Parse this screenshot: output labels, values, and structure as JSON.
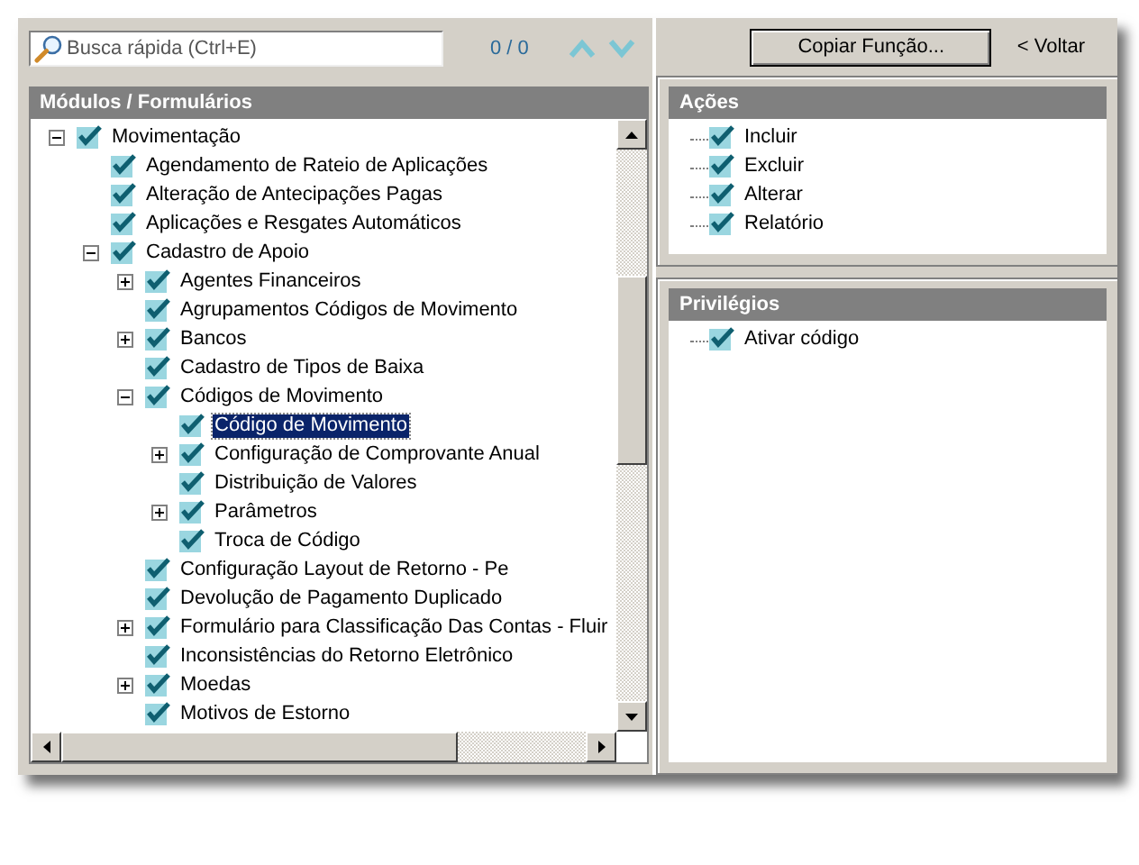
{
  "search": {
    "placeholder": "Busca rápida (Ctrl+E)",
    "count": "0 / 0"
  },
  "modules": {
    "title": "Módulos / Formulários",
    "items": [
      {
        "label": "Movimentação",
        "checked": true,
        "selected": false,
        "expanded": true,
        "children": [
          {
            "label": "Agendamento de Rateio de Aplicações",
            "checked": true,
            "selected": false
          },
          {
            "label": "Alteração de Antecipações Pagas",
            "checked": true,
            "selected": false
          },
          {
            "label": "Aplicações e Resgates Automáticos",
            "checked": true,
            "selected": false
          },
          {
            "label": "Cadastro de Apoio",
            "checked": true,
            "selected": false,
            "expanded": true,
            "children": [
              {
                "label": "Agentes Financeiros",
                "checked": true,
                "selected": false,
                "expanded": false
              },
              {
                "label": "Agrupamentos Códigos de Movimento",
                "checked": true,
                "selected": false
              },
              {
                "label": "Bancos",
                "checked": true,
                "selected": false,
                "expanded": false
              },
              {
                "label": "Cadastro de Tipos de Baixa",
                "checked": true,
                "selected": false
              },
              {
                "label": "Códigos de Movimento",
                "checked": true,
                "selected": false,
                "expanded": true,
                "children": [
                  {
                    "label": "Código de Movimento",
                    "checked": true,
                    "selected": true
                  },
                  {
                    "label": "Configuração de Comprovante Anual",
                    "checked": true,
                    "selected": false,
                    "expanded": false
                  },
                  {
                    "label": "Distribuição de Valores",
                    "checked": true,
                    "selected": false
                  },
                  {
                    "label": "Parâmetros",
                    "checked": true,
                    "selected": false,
                    "expanded": false
                  },
                  {
                    "label": "Troca de Código",
                    "checked": true,
                    "selected": false
                  }
                ]
              },
              {
                "label": "Configuração Layout de Retorno - Pe",
                "checked": true,
                "selected": false
              },
              {
                "label": "Devolução de Pagamento Duplicado",
                "checked": true,
                "selected": false
              },
              {
                "label": "Formulário para Classificação Das Contas - Fluir",
                "checked": true,
                "selected": false,
                "expanded": false
              },
              {
                "label": "Inconsistências do Retorno Eletrônico",
                "checked": true,
                "selected": false
              },
              {
                "label": "Moedas",
                "checked": true,
                "selected": false,
                "expanded": false
              },
              {
                "label": "Motivos de Estorno",
                "checked": true,
                "selected": false
              }
            ]
          }
        ]
      }
    ]
  },
  "copy_button": "Copiar Função...",
  "back_link": "< Voltar",
  "actions": {
    "title": "Ações",
    "items": [
      {
        "label": "Incluir",
        "checked": true
      },
      {
        "label": "Excluir",
        "checked": true
      },
      {
        "label": "Alterar",
        "checked": true
      },
      {
        "label": "Relatório",
        "checked": true
      }
    ]
  },
  "privileges": {
    "title": "Privilégios",
    "items": [
      {
        "label": "Ativar código",
        "checked": true
      }
    ]
  }
}
